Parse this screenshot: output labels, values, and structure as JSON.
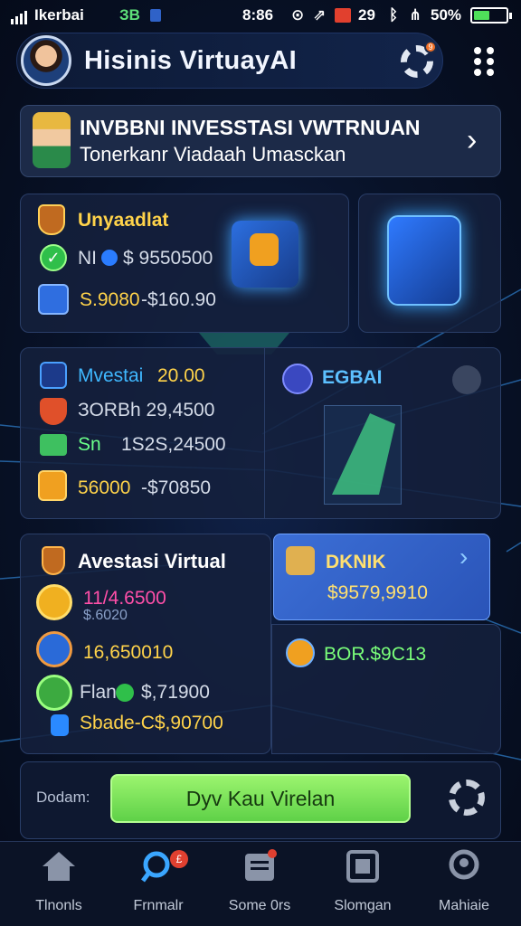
{
  "status_bar": {
    "carrier": "Ikerbai",
    "carrier_badge": "ЗВ",
    "time": "8:86",
    "number": "29",
    "battery": "50%",
    "battery_level": 0.5
  },
  "header": {
    "title": "Hisinis VirtuayAI",
    "settings_badge": "9"
  },
  "banner": {
    "title": "INVBBNI INVESSTASI VWTRNUAN",
    "subtitle": "Tonerkanr Viadaah Umasckan"
  },
  "card_top": {
    "title": "Unyaadlat",
    "row1_label": "NI",
    "row1_value": "$ 9550500",
    "row2_value": "S.9080",
    "row2_extra": "-$160.90"
  },
  "card_mid": {
    "row1_label": "Mvestai",
    "row1_value": "20.00",
    "row2_value": "ЗОRBh 29,4500",
    "row3_label": "Sn",
    "row3_value": "1S2S,24500",
    "row4_value": "56000",
    "row4_extra": "-$70850",
    "right_label": "EGBAI"
  },
  "card_low": {
    "title": "Avestasi Virtual",
    "row1_value": "11/4.6500",
    "row1_sub": "$.6020",
    "row2_value": "16,650010",
    "row3_label": "Flan",
    "row3_value": "$,71900",
    "row4_value": "Sbade-C$,90700"
  },
  "card_blue": {
    "label": "DKNIK",
    "value": "$9579,9910"
  },
  "card_extra": {
    "value": "BOR.$9C13"
  },
  "cta": {
    "left_label": "Dodam:",
    "button_label": "Dyv Kau Virelan"
  },
  "tabs": [
    {
      "label": "Tlnonls",
      "icon": "home-icon"
    },
    {
      "label": "Frnmalr",
      "icon": "search-icon",
      "badge": "£"
    },
    {
      "label": "Some 0rs",
      "icon": "document-icon"
    },
    {
      "label": "Slomgan",
      "icon": "scan-icon"
    },
    {
      "label": "Mahiaie",
      "icon": "profile-icon"
    }
  ],
  "colors": {
    "background": "#081228",
    "accent_green": "#5fd148",
    "accent_blue": "#3c6fd6",
    "accent_yellow": "#ffd34a"
  }
}
